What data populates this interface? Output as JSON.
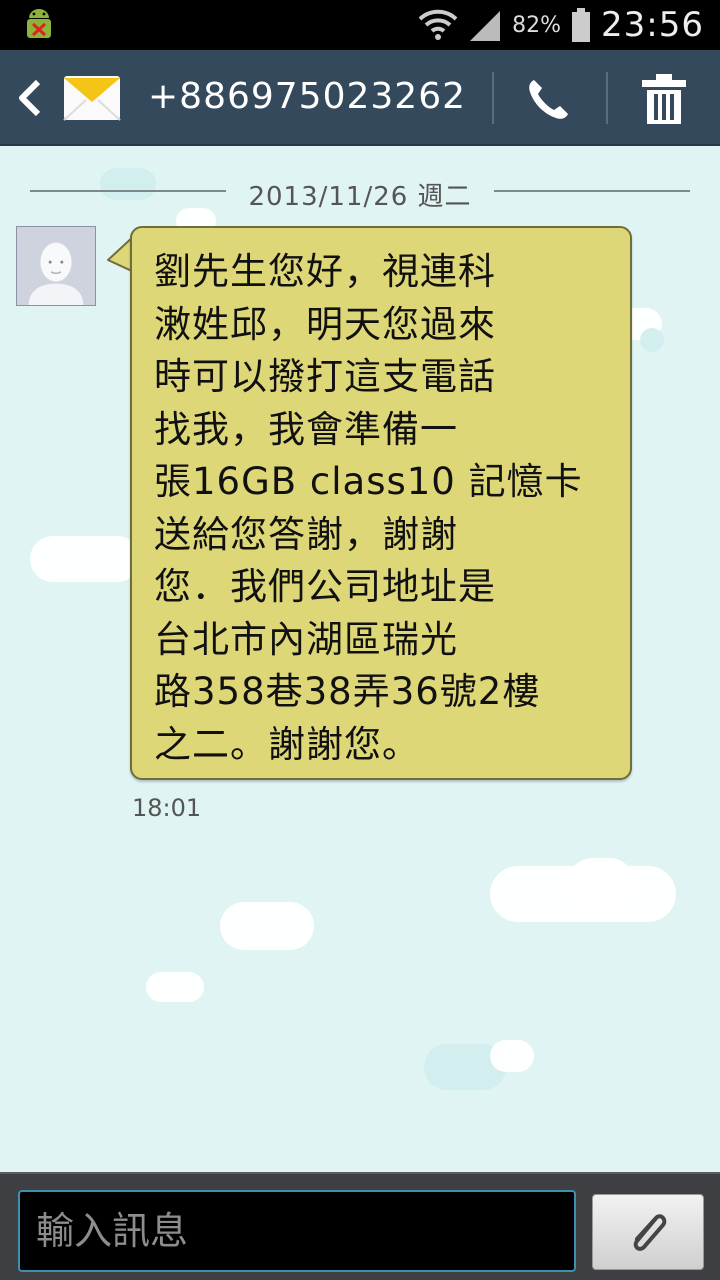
{
  "status_bar": {
    "battery_percent": "82%",
    "time": "23:56",
    "icons": [
      "android-debug-icon",
      "wifi-icon",
      "signal-icon",
      "battery-icon"
    ]
  },
  "header": {
    "contact": "+886975023262",
    "icons": [
      "back-icon",
      "envelope-icon",
      "phone-icon",
      "trash-icon"
    ]
  },
  "conversation": {
    "date": "2013/11/26 週二",
    "messages": [
      {
        "text": "劉先生您好，視連科\n潄姓邱，明天您過來\n時可以撥打這支電話\n找我，我會準備一\n張16GB class10 記憶卡\n送給您答謝，謝謝\n您．我們公司地址是\n台北市內湖區瑞光\n路358巷38弄36號2樓\n之二。謝謝您。",
        "time": "18:01"
      }
    ]
  },
  "composer": {
    "placeholder": "輸入訊息",
    "value": ""
  },
  "colors": {
    "status_bar": "#000000",
    "action_bar": "#34495c",
    "background": "#dff4f3",
    "bubble": "#ded777",
    "input_bar": "#3d3f42",
    "input_focus_border": "#3f8fb0"
  }
}
